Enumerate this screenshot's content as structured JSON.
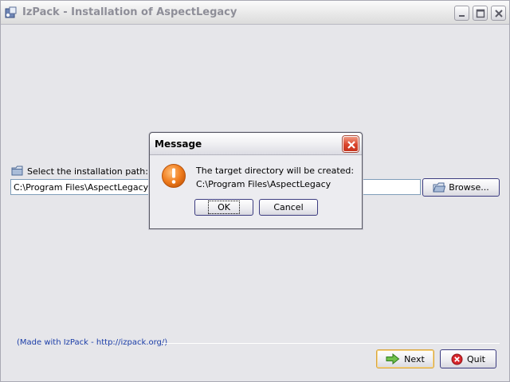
{
  "window": {
    "title": "IzPack - Installation of AspectLegacy",
    "controls": [
      "minimize-icon",
      "maximize-icon",
      "close-icon"
    ]
  },
  "install_path": {
    "label": "Select the installation path:",
    "value": "C:\\Program Files\\AspectLegacy",
    "browse_label": "Browse..."
  },
  "footer": {
    "made_with": "(Made with IzPack - http://izpack.org/)",
    "next_label": "Next",
    "quit_label": "Quit"
  },
  "dialog": {
    "title": "Message",
    "message_line1": "The target directory will be created:",
    "message_line2": "C:\\Program Files\\AspectLegacy",
    "ok_label": "OK",
    "cancel_label": "Cancel",
    "icon": "warning-icon"
  },
  "colors": {
    "accent_link": "#1c3ea8",
    "warning": "#f07d1e",
    "close_red": "#d9432b"
  }
}
